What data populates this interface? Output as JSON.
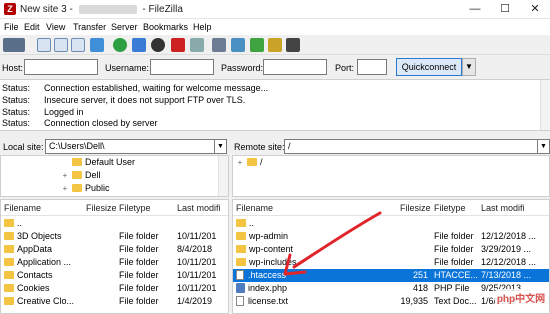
{
  "window": {
    "title_prefix": "New site 3 - ",
    "title_suffix": " - FileZilla",
    "minimize": "—",
    "maximize": "☐",
    "close": "✕"
  },
  "menu": [
    "File",
    "Edit",
    "View",
    "Transfer",
    "Server",
    "Bookmarks",
    "Help"
  ],
  "toolbar_icons": [
    "site-manager-icon",
    "toggle-log-icon",
    "toggle-local-tree-icon",
    "toggle-remote-tree-icon",
    "transfer-queue-icon",
    "refresh-icon",
    "process-queue-icon",
    "cancel-icon",
    "disconnect-icon",
    "reconnect-icon",
    "filter-icon",
    "compare-icon",
    "sync-browse-icon",
    "search-icon",
    "binoculars-icon"
  ],
  "quickconnect": {
    "host_label": "Host:",
    "username_label": "Username:",
    "password_label": "Password:",
    "port_label": "Port:",
    "button": "Quickconnect",
    "dropdown": "▼"
  },
  "log": [
    {
      "status": "Status:",
      "msg": "Connection established, waiting for welcome message..."
    },
    {
      "status": "Status:",
      "msg": "Insecure server, it does not support FTP over TLS."
    },
    {
      "status": "Status:",
      "msg": "Logged in"
    },
    {
      "status": "Status:",
      "msg": "Connection closed by server"
    }
  ],
  "local": {
    "label": "Local site:",
    "path": "C:\\Users\\Dell\\",
    "tree": [
      {
        "name": "Default User",
        "exp": ""
      },
      {
        "name": "Dell",
        "exp": "+"
      },
      {
        "name": "Public",
        "exp": "+"
      }
    ],
    "headers": {
      "filename": "Filename",
      "filesize": "Filesize",
      "filetype": "Filetype",
      "modified": "Last modifi"
    },
    "files": [
      {
        "name": "..",
        "size": "",
        "type": "",
        "date": ""
      },
      {
        "name": "3D Objects",
        "size": "",
        "type": "File folder",
        "date": "10/11/201"
      },
      {
        "name": "AppData",
        "size": "",
        "type": "File folder",
        "date": "8/4/2018"
      },
      {
        "name": "Application ...",
        "size": "",
        "type": "File folder",
        "date": "10/11/201"
      },
      {
        "name": "Contacts",
        "size": "",
        "type": "File folder",
        "date": "10/11/201"
      },
      {
        "name": "Cookies",
        "size": "",
        "type": "File folder",
        "date": "10/11/201"
      },
      {
        "name": "Creative Clo...",
        "size": "",
        "type": "File folder",
        "date": "1/4/2019"
      }
    ]
  },
  "remote": {
    "label": "Remote site:",
    "path": "/",
    "tree": [
      {
        "name": "/",
        "exp": "+"
      }
    ],
    "headers": {
      "filename": "Filename",
      "filesize": "Filesize",
      "filetype": "Filetype",
      "modified": "Last modifi"
    },
    "files": [
      {
        "name": "..",
        "size": "",
        "type": "",
        "date": "",
        "icon": "folder"
      },
      {
        "name": "wp-admin",
        "size": "",
        "type": "File folder",
        "date": "12/12/2018 ...",
        "icon": "folder"
      },
      {
        "name": "wp-content",
        "size": "",
        "type": "File folder",
        "date": "3/29/2019 ...",
        "icon": "folder"
      },
      {
        "name": "wp-includes",
        "size": "",
        "type": "File folder",
        "date": "12/12/2018 ...",
        "icon": "folder"
      },
      {
        "name": ".htaccess",
        "size": "251",
        "type": "HTACCE...",
        "date": "7/13/2018 ...",
        "icon": "file",
        "selected": true
      },
      {
        "name": "index.php",
        "size": "418",
        "type": "PHP File",
        "date": "9/25/2013 ...",
        "icon": "php"
      },
      {
        "name": "license.txt",
        "size": "19,935",
        "type": "Text Doc...",
        "date": "1/6/2019 ...",
        "icon": "file"
      }
    ]
  },
  "colors": {
    "selection": "#0a74d8",
    "arrow": "#e0242a",
    "folder": "#f4c542",
    "quickconnect_border": "#2a7ad4"
  }
}
